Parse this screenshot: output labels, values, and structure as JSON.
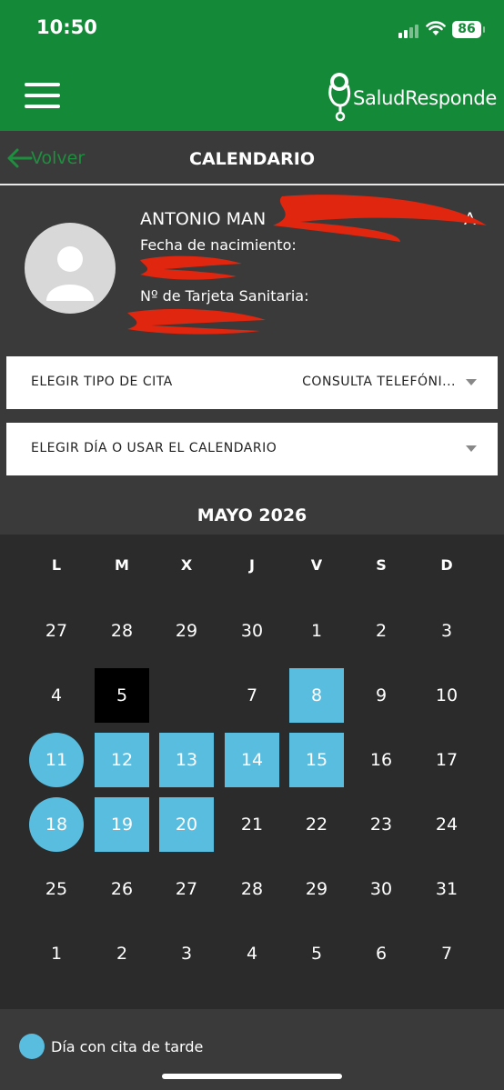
{
  "status": {
    "time": "10:50",
    "battery": "86"
  },
  "appbar": {
    "logo_text": "SaludResponde",
    "menu_icon": "hamburger-icon"
  },
  "nav": {
    "back_label": "Volver",
    "title": "CALENDARIO"
  },
  "profile": {
    "name": "ANTONIO MAN",
    "name_tail": "A",
    "birth_label": "Fecha de nacimiento:",
    "card_label": "Nº de Tarjeta Sanitaria:"
  },
  "appointment_type": {
    "label": "ELEGIR TIPO DE CITA",
    "value": "CONSULTA TELEFÓNI..."
  },
  "day_select": {
    "label": "ELEGIR DÍA O USAR EL CALENDARIO"
  },
  "calendar": {
    "month": "MAYO 2026",
    "weekdays": [
      "L",
      "M",
      "X",
      "J",
      "V",
      "S",
      "D"
    ],
    "weeks": [
      [
        "27",
        "28",
        "29",
        "30",
        "1",
        "2",
        "3"
      ],
      [
        "4",
        "5",
        "",
        "7",
        "8",
        "9",
        "10"
      ],
      [
        "11",
        "12",
        "13",
        "14",
        "15",
        "16",
        "17"
      ],
      [
        "18",
        "19",
        "20",
        "21",
        "22",
        "23",
        "24"
      ],
      [
        "25",
        "26",
        "27",
        "28",
        "29",
        "30",
        "31"
      ],
      [
        "1",
        "2",
        "3",
        "4",
        "5",
        "6",
        "7"
      ]
    ],
    "states": [
      [
        "",
        "",
        "",
        "",
        "",
        "",
        ""
      ],
      [
        "",
        "selected",
        "",
        "",
        "avail",
        "",
        ""
      ],
      [
        "afternoon",
        "avail",
        "avail",
        "avail",
        "avail",
        "",
        ""
      ],
      [
        "afternoon",
        "avail",
        "avail",
        "",
        "",
        "",
        ""
      ],
      [
        "",
        "",
        "",
        "",
        "",
        "",
        ""
      ],
      [
        "",
        "",
        "",
        "",
        "",
        "",
        ""
      ]
    ],
    "colors": {
      "available": "#59bde0",
      "selected": "#000000"
    }
  },
  "legend": {
    "afternoon_label": "Día con cita de tarde"
  },
  "colors": {
    "brand": "#148a38",
    "background": "#3a3a3a",
    "calendar_bg": "#2b2b2b"
  }
}
